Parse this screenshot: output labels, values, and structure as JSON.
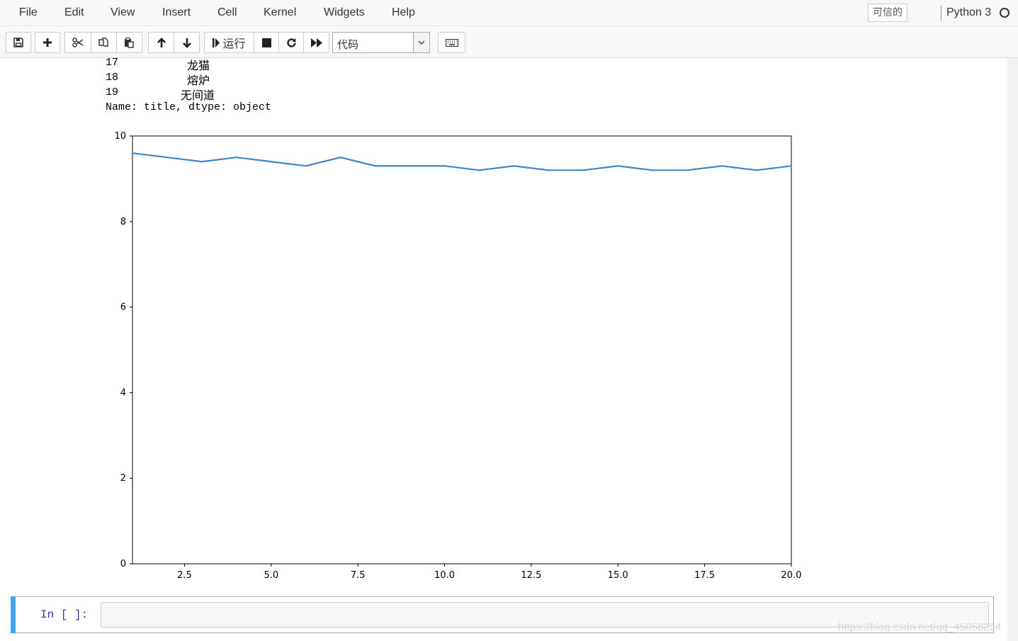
{
  "menubar": {
    "items": [
      "File",
      "Edit",
      "View",
      "Insert",
      "Cell",
      "Kernel",
      "Widgets",
      "Help"
    ],
    "trusted_label": "可信的",
    "kernel_name": "Python 3"
  },
  "toolbar": {
    "run_label": "运行",
    "cell_type_value": "代码",
    "icons": [
      "save-icon",
      "plus-icon",
      "cut-icon",
      "copy-icon",
      "paste-icon",
      "arrow-up-icon",
      "arrow-down-icon",
      "step-forward-icon",
      "stop-icon",
      "restart-icon",
      "fast-forward-icon",
      "keyboard-icon"
    ]
  },
  "output": {
    "rows": [
      {
        "index": "17",
        "value": "龙猫"
      },
      {
        "index": "18",
        "value": "熔炉"
      },
      {
        "index": "19",
        "value": "无间道"
      }
    ],
    "footer": "Name: title, dtype: object"
  },
  "chart_data": {
    "type": "line",
    "x": [
      1,
      2,
      3,
      4,
      5,
      6,
      7,
      8,
      9,
      10,
      11,
      12,
      13,
      14,
      15,
      16,
      17,
      18,
      19,
      20
    ],
    "series": [
      {
        "values": [
          9.6,
          9.5,
          9.4,
          9.5,
          9.4,
          9.3,
          9.5,
          9.3,
          9.3,
          9.3,
          9.2,
          9.3,
          9.2,
          9.2,
          9.3,
          9.2,
          9.2,
          9.3,
          9.2,
          9.3
        ],
        "color": "#3d85c6"
      }
    ],
    "xlim": [
      1,
      20
    ],
    "ylim": [
      0,
      10
    ],
    "xticks": [
      "2.5",
      "5.0",
      "7.5",
      "10.0",
      "12.5",
      "15.0",
      "17.5",
      "20.0"
    ],
    "xtick_values": [
      2.5,
      5.0,
      7.5,
      10.0,
      12.5,
      15.0,
      17.5,
      20.0
    ],
    "yticks": [
      "0",
      "2",
      "4",
      "6",
      "8",
      "10"
    ],
    "ytick_values": [
      0,
      2,
      4,
      6,
      8,
      10
    ],
    "grid": false
  },
  "input_cell": {
    "prompt": "In [ ]:"
  },
  "watermark": "https://blog.csdn.net/qq_45058254"
}
